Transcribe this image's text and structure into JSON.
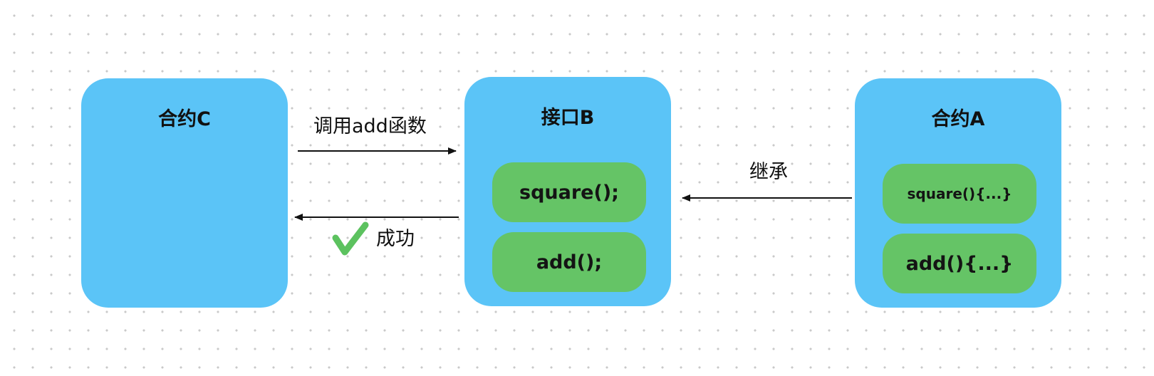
{
  "contract_c": {
    "title": "合约C"
  },
  "interface_b": {
    "title": "接口B",
    "methods": [
      "square();",
      "add();"
    ]
  },
  "contract_a": {
    "title": "合约A",
    "methods": [
      "square(){...}",
      "add(){...}"
    ]
  },
  "edges": {
    "call": {
      "label": "调用add函数"
    },
    "success": {
      "label": "成功",
      "icon": "checkmark-icon"
    },
    "inherit": {
      "label": "继承"
    }
  },
  "colors": {
    "card": "#5bc4f7",
    "method": "#65c466",
    "check": "#5cc25f",
    "arrow": "#111111"
  }
}
